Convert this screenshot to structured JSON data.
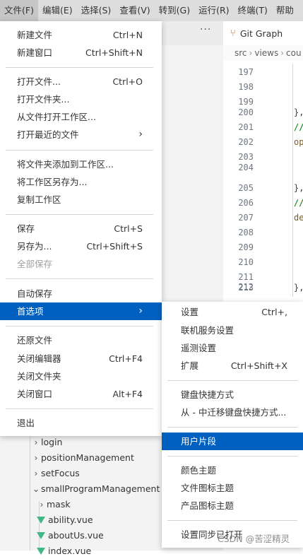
{
  "menubar": {
    "items": [
      "文件(F)",
      "编辑(E)",
      "选择(S)",
      "查看(V)",
      "转到(G)",
      "运行(R)",
      "终端(T)",
      "帮助"
    ]
  },
  "editor": {
    "more_icon": "···",
    "tab_label": "Git Graph",
    "tab_icon": "git-graph-icon",
    "breadcrumb": [
      "src",
      "views",
      "cou"
    ],
    "line_numbers": [
      "197",
      "198",
      "199",
      "200",
      "201",
      "202",
      "203",
      "204",
      "205",
      "206",
      "207",
      "208",
      "209",
      "210",
      "211",
      "212",
      "213"
    ],
    "code": {
      "l200": "},",
      "l201": "//",
      "l202": "op",
      "l205": "},",
      "l206": "//",
      "l207": "de",
      "l213": "},"
    }
  },
  "file_menu": {
    "new_file": {
      "label": "新建文件",
      "shortcut": "Ctrl+N"
    },
    "new_window": {
      "label": "新建窗口",
      "shortcut": "Ctrl+Shift+N"
    },
    "open_file": {
      "label": "打开文件...",
      "shortcut": "Ctrl+O"
    },
    "open_folder": {
      "label": "打开文件夹..."
    },
    "open_workspace": {
      "label": "从文件打开工作区..."
    },
    "open_recent": {
      "label": "打开最近的文件"
    },
    "add_folder": {
      "label": "将文件夹添加到工作区..."
    },
    "save_workspace_as": {
      "label": "将工作区另存为..."
    },
    "duplicate_workspace": {
      "label": "复制工作区"
    },
    "save": {
      "label": "保存",
      "shortcut": "Ctrl+S"
    },
    "save_as": {
      "label": "另存为...",
      "shortcut": "Ctrl+Shift+S"
    },
    "save_all": {
      "label": "全部保存"
    },
    "auto_save": {
      "label": "自动保存"
    },
    "preferences": {
      "label": "首选项"
    },
    "revert_file": {
      "label": "还原文件"
    },
    "close_editor": {
      "label": "关闭编辑器",
      "shortcut": "Ctrl+F4"
    },
    "close_folder": {
      "label": "关闭文件夹"
    },
    "close_window": {
      "label": "关闭窗口",
      "shortcut": "Alt+F4"
    },
    "exit": {
      "label": "退出"
    }
  },
  "preferences_menu": {
    "settings": {
      "label": "设置",
      "shortcut": "Ctrl+,"
    },
    "online_services": {
      "label": "联机服务设置"
    },
    "telemetry": {
      "label": "遥测设置"
    },
    "extensions": {
      "label": "扩展",
      "shortcut": "Ctrl+Shift+X"
    },
    "keyboard_shortcuts": {
      "label": "键盘快捷方式"
    },
    "migrate_keybindings": {
      "label": "从 - 中迁移键盘快捷方式..."
    },
    "user_snippets": {
      "label": "用户片段"
    },
    "color_theme": {
      "label": "颜色主题"
    },
    "file_icon_theme": {
      "label": "文件图标主题"
    },
    "product_icon_theme": {
      "label": "产品图标主题"
    },
    "settings_sync": {
      "label": "设置同步已打开"
    }
  },
  "explorer": {
    "items": [
      {
        "label": "login",
        "type": "folder"
      },
      {
        "label": "positionManagement",
        "type": "folder"
      },
      {
        "label": "setFocus",
        "type": "folder"
      },
      {
        "label": "smallProgramManagement",
        "type": "folder-open"
      },
      {
        "label": "mask",
        "type": "folder"
      },
      {
        "label": "ability.vue",
        "type": "vue"
      },
      {
        "label": "aboutUs.vue",
        "type": "vue"
      },
      {
        "label": "index.vue",
        "type": "vue"
      }
    ]
  },
  "watermark": "CSDN @苦涩精灵",
  "colors": {
    "highlight": "#0060c0",
    "menubar_bg": "#dddddd",
    "vue_green": "#41b883"
  }
}
